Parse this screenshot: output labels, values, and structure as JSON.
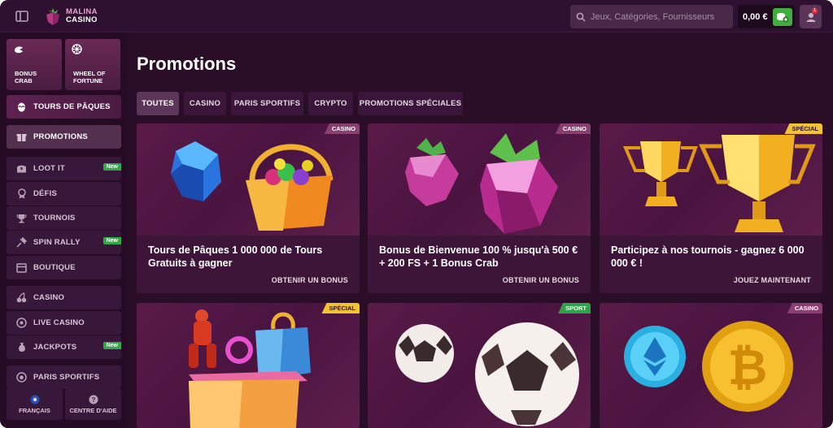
{
  "header": {
    "logo_top": "MALINA",
    "logo_bottom": "CASINO",
    "search_placeholder": "Jeux, Catégories, Fournisseurs",
    "balance": "0,00 €",
    "notification_count": "1"
  },
  "sidebar": {
    "tiles": [
      {
        "label_1": "BONUS",
        "label_2": "CRAB"
      },
      {
        "label_1": "WHEEL OF",
        "label_2": "FORTUNE"
      }
    ],
    "easter": "TOURS DE PÂQUES",
    "items": [
      {
        "label": "PROMOTIONS"
      },
      {
        "label": "LOOT IT",
        "badge": "New"
      },
      {
        "label": "DÉFIS"
      },
      {
        "label": "TOURNOIS"
      },
      {
        "label": "SPIN RALLY",
        "badge": "New"
      },
      {
        "label": "BOUTIQUE"
      },
      {
        "label": "CASINO"
      },
      {
        "label": "LIVE CASINO"
      },
      {
        "label": "JACKPOTS",
        "badge": "New"
      },
      {
        "label": "PARIS SPORTIFS"
      }
    ],
    "footer": {
      "language": "FRANÇAIS",
      "help": "CENTRE D'AIDE"
    }
  },
  "main": {
    "title": "Promotions",
    "tabs": [
      "TOUTES",
      "CASINO",
      "PARIS SPORTIFS",
      "CRYPTO",
      "PROMOTIONS SPÉCIALES"
    ],
    "cards": [
      {
        "badge": "CASINO",
        "title": "Tours de Pâques 1 000 000 de Tours Gratuits à gagner",
        "cta": "OBTENIR UN BONUS"
      },
      {
        "badge": "CASINO",
        "title": "Bonus de Bienvenue 100 % jusqu'à 500 € + 200 FS + 1 Bonus Crab",
        "cta": "OBTENIR UN BONUS"
      },
      {
        "badge": "SPÉCIAL",
        "title": "Participez à nos tournois - gagnez 6 000 000 € !",
        "cta": "JOUEZ MAINTENANT"
      },
      {
        "badge": "SPÉCIAL"
      },
      {
        "badge": "SPORT"
      },
      {
        "badge": "CASINO"
      }
    ]
  },
  "colors": {
    "background": "#2a0e28",
    "accent_green": "#3fae3c",
    "special_yellow": "#f2c230",
    "casino_badge": "#8a3f72"
  }
}
